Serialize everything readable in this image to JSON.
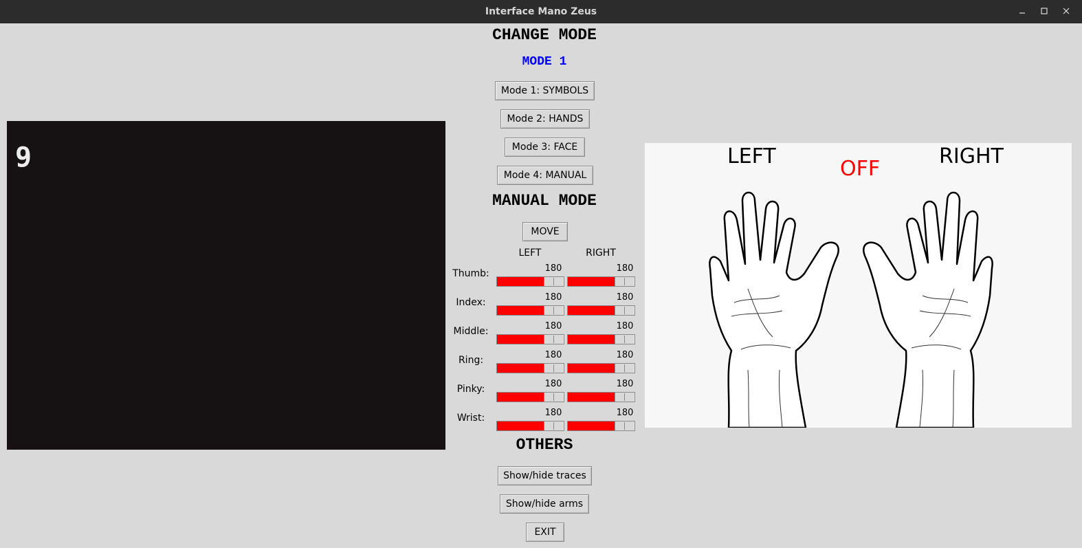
{
  "window": {
    "title": "Interface Mano Zeus"
  },
  "camera": {
    "counter": "9"
  },
  "change_mode": {
    "heading": "CHANGE MODE",
    "current_mode": "MODE 1",
    "buttons": [
      "Mode 1: SYMBOLS",
      "Mode 2: HANDS",
      "Mode 3: FACE",
      "Mode 4: MANUAL"
    ]
  },
  "manual_mode": {
    "heading": "MANUAL MODE",
    "move_label": "MOVE",
    "column_left": "LEFT",
    "column_right": "RIGHT",
    "fingers": [
      {
        "label": "Thumb:",
        "left": "180",
        "right": "180"
      },
      {
        "label": "Index:",
        "left": "180",
        "right": "180"
      },
      {
        "label": "Middle:",
        "left": "180",
        "right": "180"
      },
      {
        "label": "Ring:",
        "left": "180",
        "right": "180"
      },
      {
        "label": "Pinky:",
        "left": "180",
        "right": "180"
      },
      {
        "label": "Wrist:",
        "left": "180",
        "right": "180"
      }
    ],
    "slider_fraction": 0.7,
    "slider_color": "#ff0000"
  },
  "others": {
    "heading": "OTHERS",
    "traces_label": "Show/hide traces",
    "arms_label": "Show/hide arms",
    "exit_label": "EXIT"
  },
  "hands_panel": {
    "left_label": "LEFT",
    "right_label": "RIGHT",
    "status": "OFF",
    "status_color": "#ff0000"
  }
}
